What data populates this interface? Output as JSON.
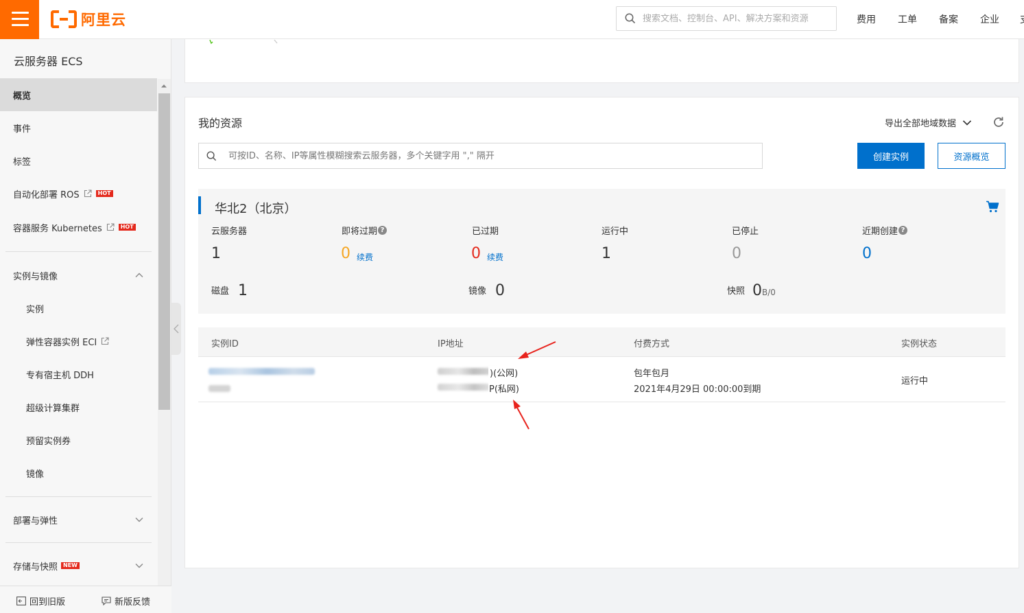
{
  "header": {
    "logo_text": "阿里云",
    "search_placeholder": "搜索文档、控制台、API、解决方案和资源",
    "nav": [
      "费用",
      "工单",
      "备案",
      "企业"
    ]
  },
  "sidebar": {
    "title": "云服务器 ECS",
    "top_items": [
      {
        "label": "概览",
        "active": true
      },
      {
        "label": "事件"
      },
      {
        "label": "标签"
      },
      {
        "label": "自动化部署 ROS",
        "badge": "HOT"
      },
      {
        "label": "容器服务 Kubernetes",
        "badge": "HOT"
      }
    ],
    "group_instances": {
      "label": "实例与镜像",
      "expanded": true,
      "items": [
        "实例",
        "弹性容器实例 ECI",
        "专有宿主机 DDH",
        "超级计算集群",
        "预留实例券",
        "镜像"
      ]
    },
    "group_deploy": {
      "label": "部署与弹性",
      "expanded": false
    },
    "group_storage": {
      "label": "存储与快照",
      "badge": "NEW",
      "expanded": false
    },
    "footer": {
      "old_version": "回到旧版",
      "feedback": "新版反馈"
    }
  },
  "resources": {
    "title": "我的资源",
    "export_label": "导出全部地域数据",
    "search_placeholder": "可按ID、名称、IP等属性模糊搜索云服务器，多个关键字用 \",\" 隔开",
    "create_button": "创建实例",
    "overview_button": "资源概览",
    "region": {
      "name": "华北2（北京）",
      "stats": [
        {
          "label": "云服务器",
          "value": "1"
        },
        {
          "label": "即将过期",
          "value": "0",
          "help": true,
          "action": "续费",
          "color": "#f5a623"
        },
        {
          "label": "已过期",
          "value": "0",
          "action": "续费",
          "color": "#e4291c"
        },
        {
          "label": "运行中",
          "value": "1"
        },
        {
          "label": "已停止",
          "value": "0",
          "color": "#999999"
        },
        {
          "label": "近期创建",
          "value": "0",
          "help": true,
          "color": "#0070cc"
        }
      ],
      "secondary": [
        {
          "label": "磁盘",
          "value": "1"
        },
        {
          "label": "镜像",
          "value": "0"
        },
        {
          "label": "快照",
          "value": "0",
          "unit": "B/0"
        }
      ]
    },
    "table": {
      "columns": [
        "实例ID",
        "IP地址",
        "付费方式",
        "实例状态"
      ],
      "rows": [
        {
          "ip_public_suffix": ")(公网)",
          "ip_private_suffix": "P(私网)",
          "billing": "包年包月",
          "expire": "2021年4月29日 00:00:00到期",
          "status": "运行中"
        }
      ]
    }
  },
  "colors": {
    "brand": "#ff6a00",
    "primary": "#0070cc",
    "annotation": "#e8231d"
  }
}
